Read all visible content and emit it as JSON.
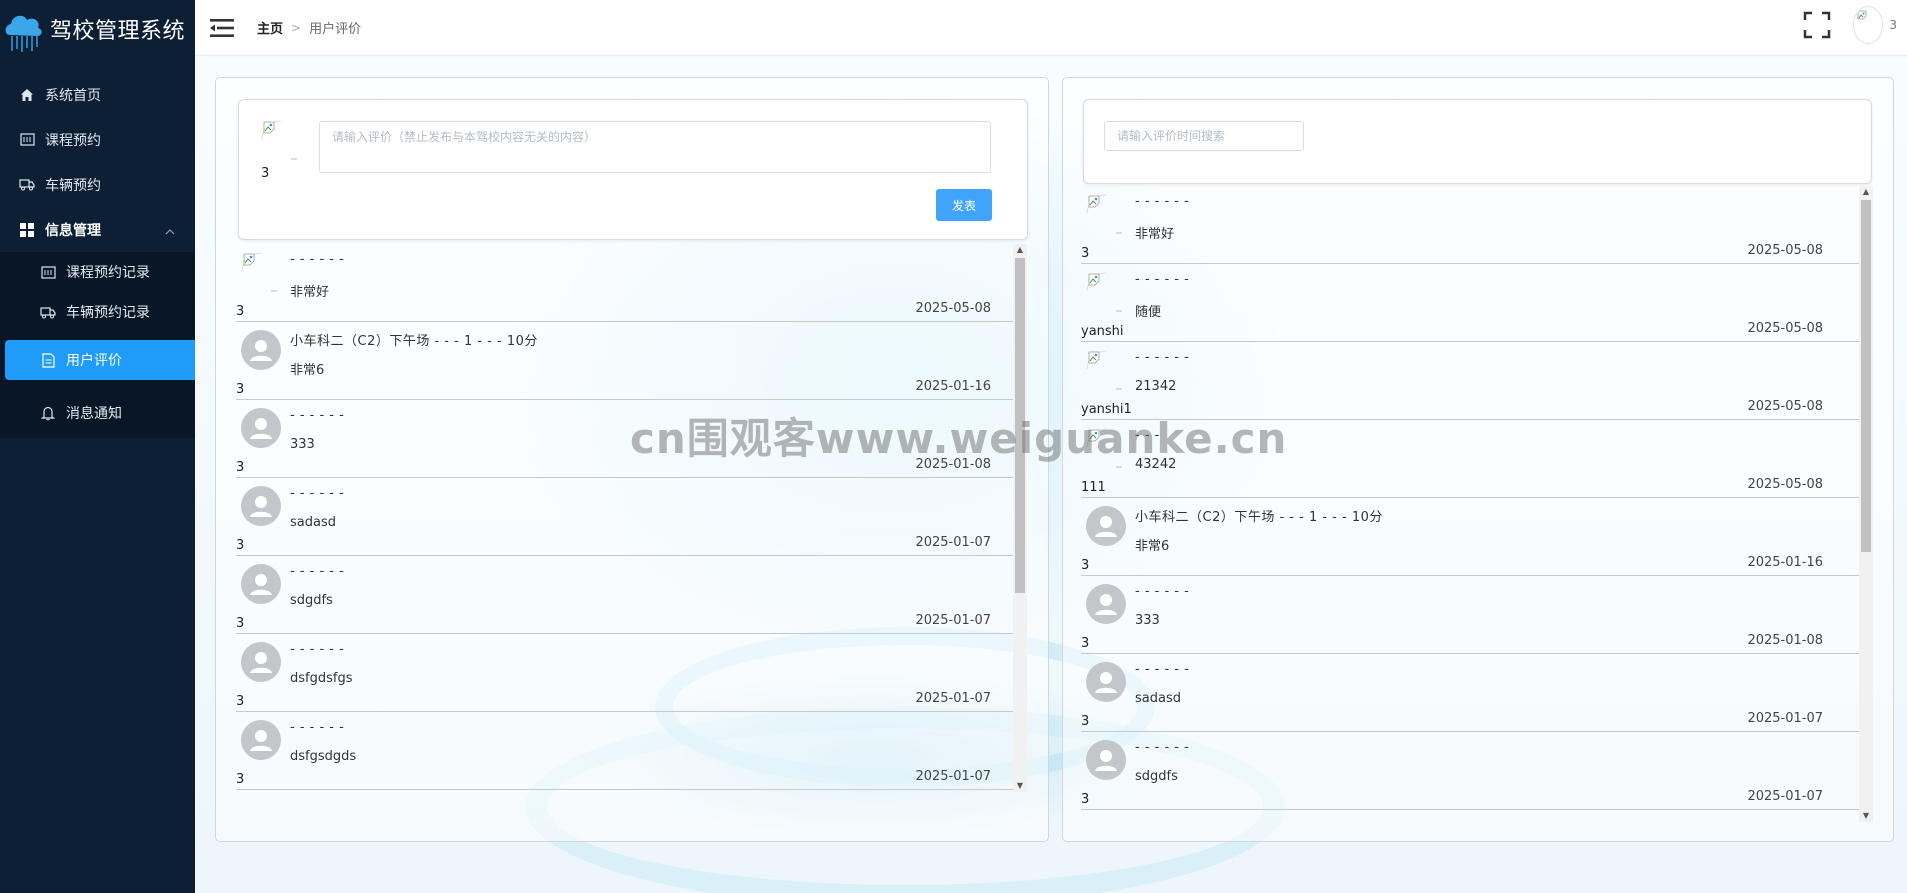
{
  "app": {
    "title": "驾校管理系统"
  },
  "sidebar": {
    "items": [
      {
        "label": "系统首页",
        "icon": "home-icon"
      },
      {
        "label": "课程预约",
        "icon": "calendar-icon"
      },
      {
        "label": "车辆预约",
        "icon": "truck-icon"
      }
    ],
    "group": {
      "label": "信息管理",
      "icon": "grid-icon",
      "children": [
        {
          "label": "课程预约记录",
          "icon": "calendar-icon"
        },
        {
          "label": "车辆预约记录",
          "icon": "truck-icon"
        },
        {
          "label": "用户评价",
          "icon": "document-icon",
          "active": true
        },
        {
          "label": "消息通知",
          "icon": "bell-icon"
        }
      ]
    }
  },
  "header": {
    "breadcrumb": {
      "home": "主页",
      "current": "用户评价"
    },
    "user": "3"
  },
  "composer": {
    "user": "3",
    "placeholder": "请输入评价（禁止发布与本驾校内容无关的内容）",
    "submit_label": "发表"
  },
  "left_list": [
    {
      "user": "3",
      "title": "- - - - - -",
      "content": "非常好",
      "date": "2025-05-08",
      "avatar": "broken"
    },
    {
      "user": "3",
      "title": "小车科二（C2）下午场 - - - 1 - - - 10分",
      "content": "非常6",
      "date": "2025-01-16",
      "avatar": "default"
    },
    {
      "user": "3",
      "title": "- - - - - -",
      "content": "333",
      "date": "2025-01-08",
      "avatar": "default"
    },
    {
      "user": "3",
      "title": "- - - - - -",
      "content": "sadasd",
      "date": "2025-01-07",
      "avatar": "default"
    },
    {
      "user": "3",
      "title": "- - - - - -",
      "content": "sdgdfs",
      "date": "2025-01-07",
      "avatar": "default"
    },
    {
      "user": "3",
      "title": "- - - - - -",
      "content": "dsfgdsfgs",
      "date": "2025-01-07",
      "avatar": "default"
    },
    {
      "user": "3",
      "title": "- - - - - -",
      "content": "dsfgsdgds",
      "date": "2025-01-07",
      "avatar": "default"
    }
  ],
  "search": {
    "placeholder": "请输入评价时间搜索"
  },
  "right_list": [
    {
      "user": "3",
      "title": "- - - - - -",
      "content": "非常好",
      "date": "2025-05-08",
      "avatar": "broken"
    },
    {
      "user": "yanshi",
      "title": "- - - - - -",
      "content": "随便",
      "date": "2025-05-08",
      "avatar": "broken"
    },
    {
      "user": "yanshi1",
      "title": "- - - - - -",
      "content": "21342",
      "date": "2025-05-08",
      "avatar": "broken"
    },
    {
      "user": "111",
      "title": "- - -",
      "content": "43242",
      "date": "2025-05-08",
      "avatar": "broken"
    },
    {
      "user": "3",
      "title": "小车科二（C2）下午场 - - - 1 - - - 10分",
      "content": "非常6",
      "date": "2025-01-16",
      "avatar": "default"
    },
    {
      "user": "3",
      "title": "- - - - - -",
      "content": "333",
      "date": "2025-01-08",
      "avatar": "default"
    },
    {
      "user": "3",
      "title": "- - - - - -",
      "content": "sadasd",
      "date": "2025-01-07",
      "avatar": "default"
    },
    {
      "user": "3",
      "title": "- - - - - -",
      "content": "sdgdfs",
      "date": "2025-01-07",
      "avatar": "default"
    }
  ],
  "watermark": "cn围观客www.weiguanke.cn",
  "colors": {
    "sidebar_bg": "#0d1f35",
    "accent": "#1f9bfa",
    "button": "#40a4fa"
  }
}
